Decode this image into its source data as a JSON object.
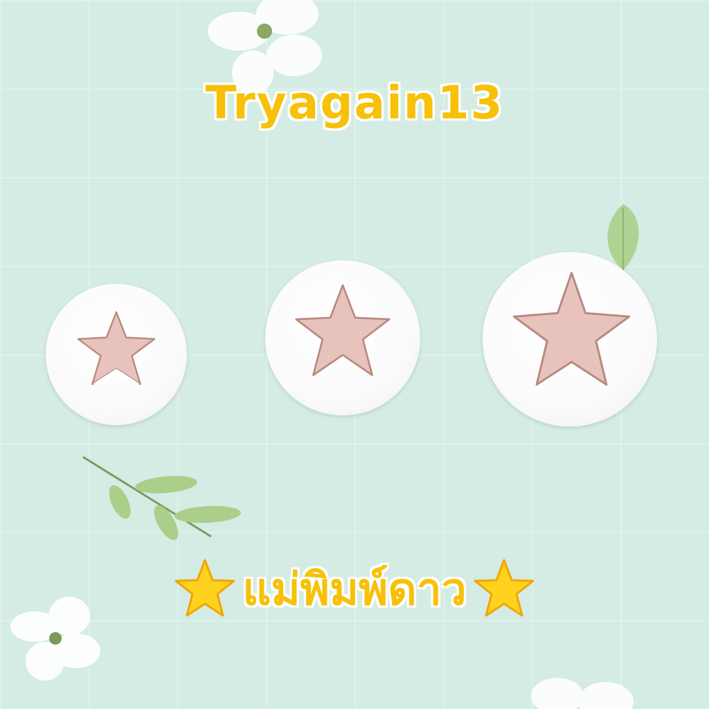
{
  "header": {
    "brand": "Tryagain13"
  },
  "product": {
    "title": "แม่พิมพ์ดาว",
    "title_icon": "star-emoji-icon"
  },
  "products": [
    {
      "name": "small-star-plunger-cutter",
      "icon": "star-icon"
    },
    {
      "name": "medium-star-plunger-cutter",
      "icon": "star-icon"
    },
    {
      "name": "large-star-plunger-cutter",
      "icon": "star-icon"
    }
  ],
  "colors": {
    "background": "#d4ece4",
    "brand_text": "#f7c10a",
    "star_fill": "#e8c3bd",
    "cutter_body": "#ffffff",
    "leaf": "#a9cf8a"
  }
}
